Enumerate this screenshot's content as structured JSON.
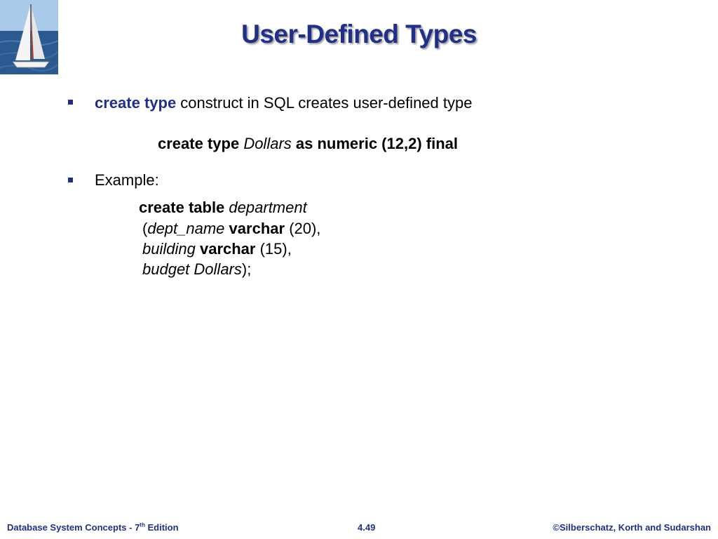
{
  "slide": {
    "title": "User-Defined Types",
    "bullets": [
      {
        "keyword": "create type",
        "text": " construct in SQL creates user-defined type",
        "code": {
          "kw1": "create type",
          "type_name": "Dollars",
          "kw2": "as numeric (12,2) final"
        }
      },
      {
        "text": "Example:",
        "code": {
          "l1_kw": "create table",
          "l1_name": "department",
          "l2_open": "(",
          "l2_col": "dept_name",
          "l2_type": "varchar",
          "l2_rest": "(20),",
          "l3_col": "building",
          "l3_type": "varchar",
          "l3_rest": "(15),",
          "l4_col": "budget",
          "l4_type": "Dollars",
          "l4_rest": ");"
        }
      }
    ]
  },
  "footer": {
    "left_prefix": "Database System Concepts - 7",
    "left_sup": "th",
    "left_suffix": " Edition",
    "center": "4.49",
    "right": "©Silberschatz, Korth and Sudarshan"
  },
  "colors": {
    "title": "#1f2f8a",
    "bullet": "#1f2f8a"
  },
  "icons": {
    "logo": "sailboat-logo-icon",
    "bullet": "square-bullet-icon"
  }
}
